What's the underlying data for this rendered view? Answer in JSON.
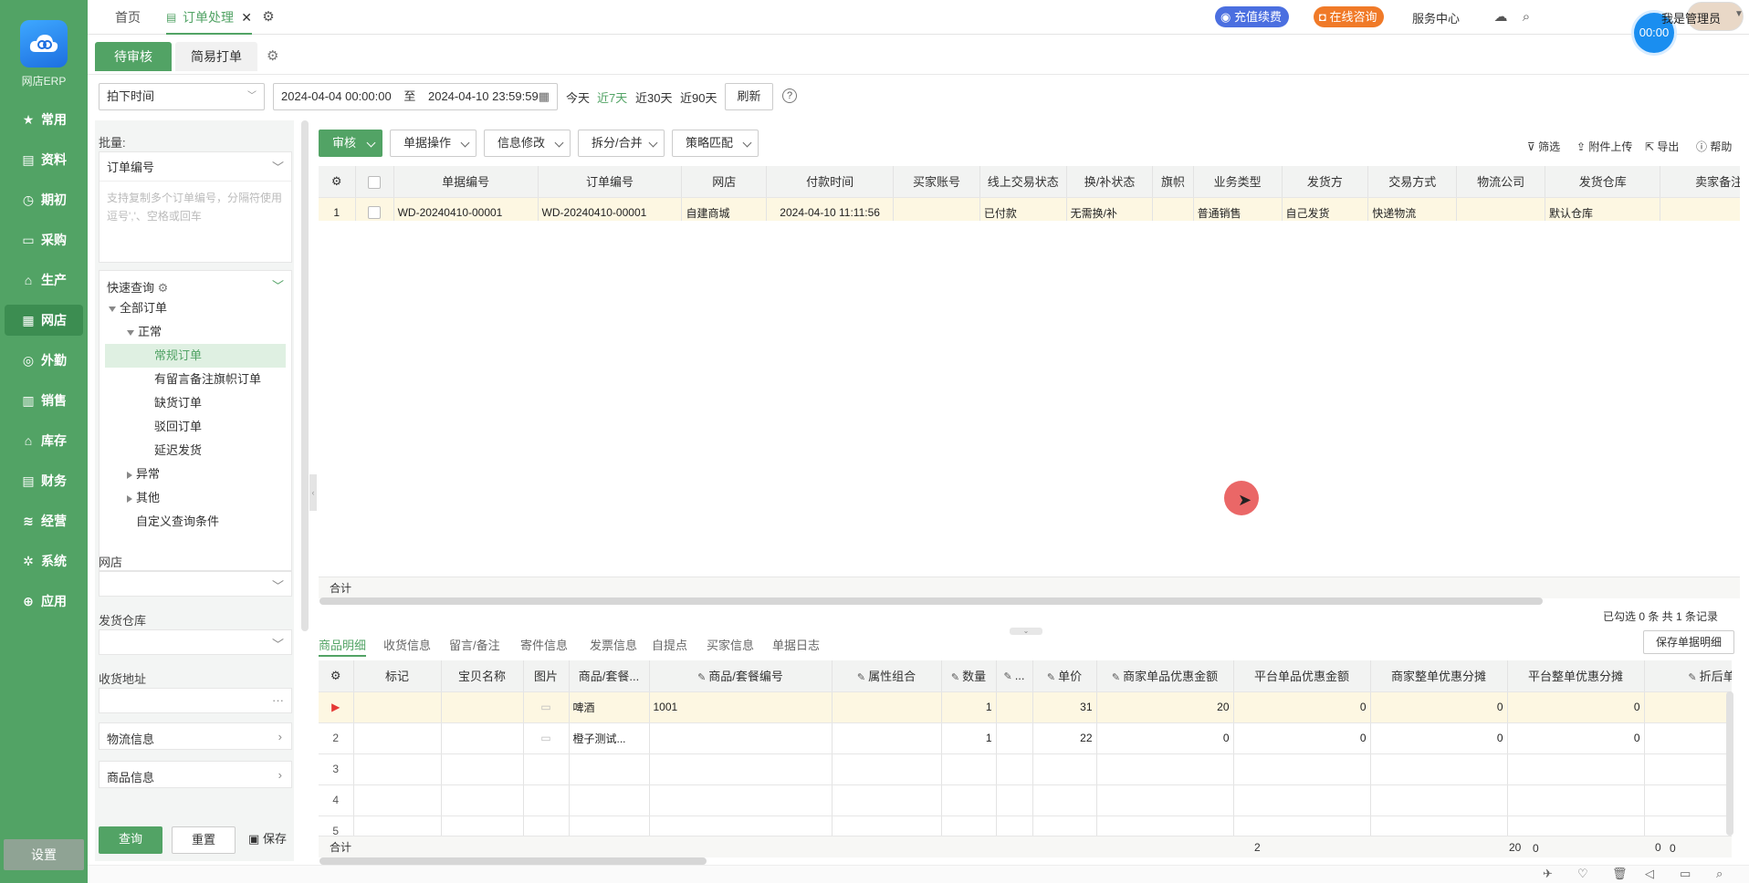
{
  "app": {
    "name": "网店ERP",
    "logo_icon": "cloud-logo"
  },
  "colors": {
    "brand": "#52a365",
    "nav_bg": "#52a365",
    "pill_blue": "#4b6fe0",
    "pill_orange": "#f07a28",
    "timer": "#1a8ef0"
  },
  "nav": {
    "items": [
      {
        "label": "常用",
        "icon": "star-icon"
      },
      {
        "label": "资料",
        "icon": "doc-icon"
      },
      {
        "label": "期初",
        "icon": "clock-icon"
      },
      {
        "label": "采购",
        "icon": "monitor-icon"
      },
      {
        "label": "生产",
        "icon": "factory-icon"
      },
      {
        "label": "网店",
        "icon": "store-icon"
      },
      {
        "label": "外勤",
        "icon": "target-icon"
      },
      {
        "label": "销售",
        "icon": "chart-icon"
      },
      {
        "label": "库存",
        "icon": "house-icon"
      },
      {
        "label": "财务",
        "icon": "ledger-icon"
      },
      {
        "label": "经营",
        "icon": "trend-icon"
      },
      {
        "label": "系统",
        "icon": "gear-icon"
      },
      {
        "label": "应用",
        "icon": "plus-icon"
      }
    ],
    "active": "网店",
    "settings": "设置"
  },
  "topbar": {
    "tabs": [
      "首页",
      "订单处理"
    ],
    "recharge": "充值续费",
    "consult": "在线咨询",
    "service": "服务中心",
    "user": "我是管理员",
    "timer": "00:00"
  },
  "subtabs": [
    "待审核",
    "简易打单"
  ],
  "filter": {
    "time_type": "拍下时间",
    "start": "2024-04-04 00:00:00",
    "to": "至",
    "end": "2024-04-10 23:59:59",
    "quick": [
      "今天",
      "近7天",
      "近30天",
      "近90天"
    ],
    "refresh": "刷新"
  },
  "left": {
    "batch_label": "批量:",
    "batch_select": "订单编号",
    "batch_placeholder": "支持复制多个订单编号，分隔符使用逗号','、空格或回车",
    "quick_query": "快速查询",
    "tree": {
      "all": "全部订单",
      "normal": "正常",
      "items": [
        "常规订单",
        "有留言备注旗帜订单",
        "缺货订单",
        "驳回订单",
        "延迟发货"
      ],
      "abnormal": "异常",
      "other": "其他",
      "custom": "自定义查询条件"
    },
    "shop_label": "网店",
    "warehouse_label": "发货仓库",
    "address_label": "收货地址",
    "logistics": "物流信息",
    "goods": "商品信息",
    "query": "查询",
    "reset": "重置",
    "save": "保存"
  },
  "toolbar": {
    "buttons": [
      "审核",
      "单据操作",
      "信息修改",
      "拆分/合并",
      "策略匹配"
    ],
    "right": [
      "筛选",
      "附件上传",
      "导出",
      "帮助"
    ]
  },
  "orders": {
    "columns": [
      "单据编号",
      "订单编号",
      "网店",
      "付款时间",
      "买家账号",
      "线上交易状态",
      "换/补状态",
      "旗帜",
      "业务类型",
      "发货方",
      "交易方式",
      "物流公司",
      "发货仓库",
      "卖家备注"
    ],
    "rows": [
      {
        "index": "1",
        "doc_no": "WD-20240410-00001",
        "order_no": "WD-20240410-00001",
        "shop": "自建商城",
        "pay_time": "2024-04-10 11:11:56",
        "buyer": "",
        "online_status": "已付款",
        "exchange": "无需换/补",
        "flag": "",
        "biz_type": "普通销售",
        "shipper": "自己发货",
        "trade": "快递物流",
        "logistics": "",
        "warehouse": "默认仓库",
        "remark": ""
      }
    ],
    "sum_label": "合计",
    "summary": "已勾选 0 条  共 1 条记录"
  },
  "detail": {
    "tabs": [
      "商品明细",
      "收货信息",
      "留言/备注",
      "寄件信息",
      "发票信息",
      "自提点",
      "买家信息",
      "单据日志"
    ],
    "save_btn": "保存单据明细",
    "columns": [
      "标记",
      "宝贝名称",
      "图片",
      "商品/套餐...",
      "商品/套餐编号",
      "属性组合",
      "数量",
      "...",
      "单价",
      "商家单品优惠金额",
      "平台单品优惠金额",
      "商家整单优惠分摊",
      "平台整单优惠分摊",
      "折后单"
    ],
    "rows": [
      {
        "index": "▶",
        "mark": "",
        "name": "",
        "img": "img-icon",
        "goods": "啤酒",
        "code": "1001",
        "attr": "",
        "qty": "1",
        "x": "",
        "price": "31",
        "m_disc": "20",
        "p_disc": "0",
        "m_share": "0",
        "p_share": "0",
        "after": ""
      },
      {
        "index": "2",
        "mark": "",
        "name": "",
        "img": "img-icon",
        "goods": "橙子测试...",
        "code": "",
        "attr": "",
        "qty": "1",
        "x": "",
        "price": "22",
        "m_disc": "0",
        "p_disc": "0",
        "m_share": "0",
        "p_share": "0",
        "after": ""
      },
      {
        "index": "3"
      },
      {
        "index": "4"
      },
      {
        "index": "5"
      }
    ],
    "sum": {
      "label": "合计",
      "qty": "2",
      "m_disc": "20",
      "p_disc": "0",
      "m_share": "0",
      "p_share": "0"
    }
  }
}
